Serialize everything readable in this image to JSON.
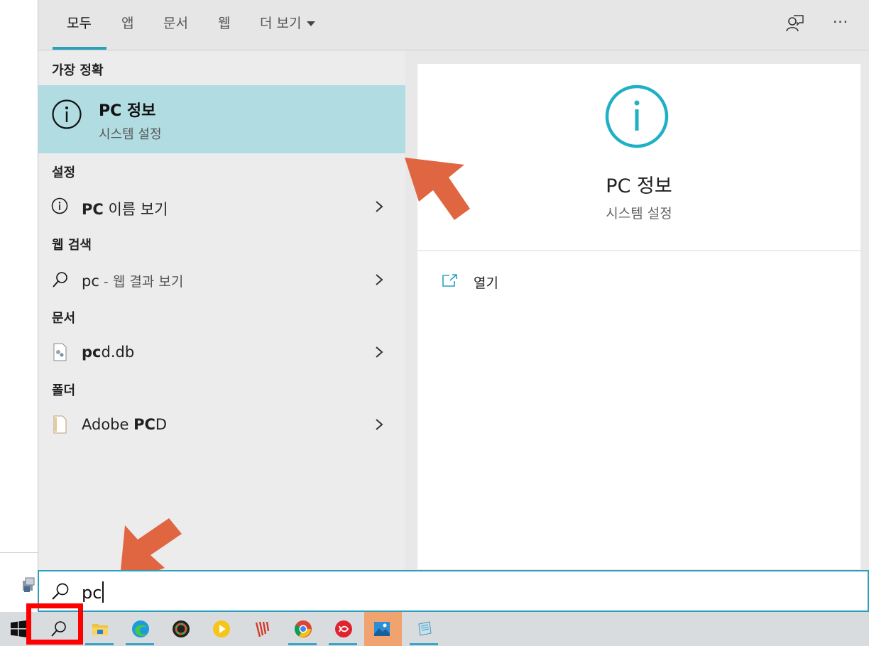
{
  "tabs": [
    {
      "label": "모두",
      "active": true
    },
    {
      "label": "앱"
    },
    {
      "label": "문서"
    },
    {
      "label": "웹"
    },
    {
      "label": "더 보기"
    }
  ],
  "top_icons": [
    "feedback-icon",
    "more-options-icon"
  ],
  "more_options_label": "···",
  "results": {
    "best_match_header": "가장 정확",
    "best_match": {
      "title": "PC 정보",
      "subtitle": "시스템 설정"
    },
    "settings_header": "설정",
    "settings_item": {
      "bold": "PC",
      "rest": " 이름 보기"
    },
    "web_header": "웹 검색",
    "web_item": {
      "query": "pc",
      "suffix": " - 웹 결과 보기"
    },
    "docs_header": "문서",
    "doc_item": {
      "bold": "pc",
      "rest": "d.db"
    },
    "folder_header": "폴더",
    "folder_item": {
      "pre": "Adobe ",
      "bold": "PC",
      "rest": "D"
    }
  },
  "preview": {
    "title": "PC 정보",
    "subtitle": "시스템 설정",
    "action": "열기"
  },
  "search": {
    "value": "pc"
  },
  "taskbar_items": [
    "windows-start-icon",
    "search-icon",
    "file-explorer-icon",
    "edge-icon",
    "color-app-icon",
    "media-player-icon",
    "fiddler-icon",
    "chrome-icon",
    "acrobat-icon",
    "photos-icon",
    "notepad-icon"
  ],
  "colors": {
    "accent": "#2aa0bf",
    "selection": "#b1dce1",
    "annotation": "#e06641",
    "highlight_box": "#ff0000"
  }
}
